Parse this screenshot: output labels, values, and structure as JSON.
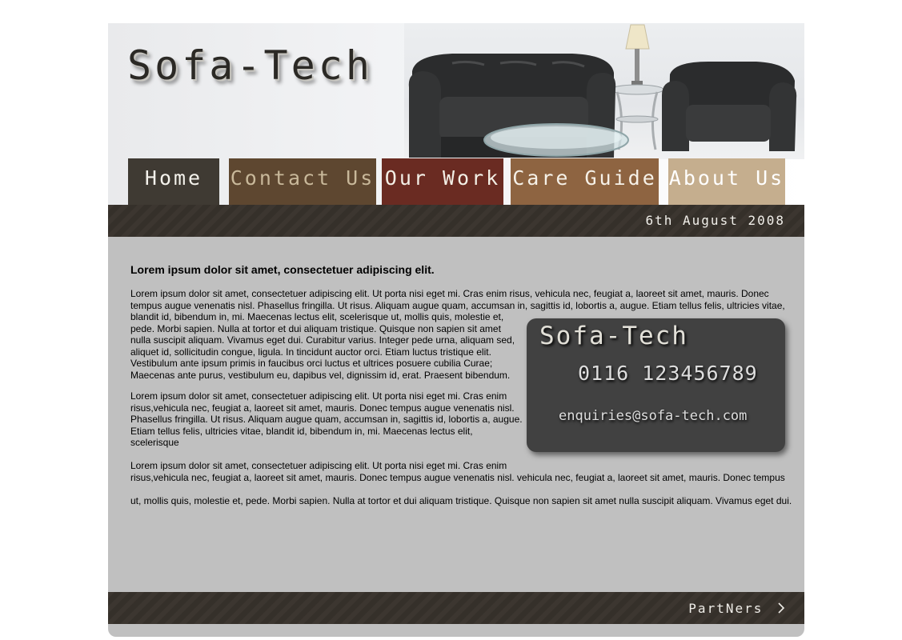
{
  "site": {
    "logo": "Sofa-Tech",
    "date": "6th August 2008"
  },
  "colors": {
    "page_background": "#c0c0c0",
    "dark_leather_bar": "#3a3530",
    "contact_card": "#414141"
  },
  "nav": {
    "items": [
      {
        "label": "Home",
        "color": "#3f3a33",
        "text_color": "#f4f2ec"
      },
      {
        "label": "Contact Us",
        "color": "#5e4730",
        "text_color": "#c8b89a"
      },
      {
        "label": "Our Work",
        "color": "#6a2b22",
        "text_color": "#f3efe6"
      },
      {
        "label": "Care Guide",
        "color": "#8e6441",
        "text_color": "#f6f1e8"
      },
      {
        "label": "About Us",
        "color": "#c5ae8e",
        "text_color": "#ffffff"
      }
    ]
  },
  "content": {
    "heading": "Lorem ipsum dolor sit amet, consectetuer adipiscing elit.",
    "paragraph1": [
      "Lorem ipsum dolor sit amet, consectetuer adipiscing elit. Ut porta nisi eget mi. Cras enim risus, vehicula nec, feugiat a, laoreet sit amet, mauris. Donec",
      "tempus augue venenatis nisl. Phasellus fringilla. Ut risus. Aliquam augue quam, accumsan in, sagittis id, lobortis a, augue. Etiam tellus felis, ultricies vitae,",
      "blandit id, bibendum in, mi. Maecenas lectus elit, scelerisque ut, mollis quis, molestie et,",
      "pede. Morbi sapien. Nulla at tortor et dui aliquam tristique. Quisque non sapien sit amet",
      " nulla suscipit aliquam. Vivamus eget dui. Curabitur varius. Integer pede urna, aliquam sed,",
      " aliquet id, sollicitudin congue, ligula. In tincidunt auctor orci. Etiam luctus tristique elit.",
      "Vestibulum ante ipsum primis in faucibus orci luctus et ultrices posuere cubilia Curae;",
      "Maecenas ante purus, vestibulum eu, dapibus vel, dignissim id, erat. Praesent bibendum."
    ],
    "paragraph2": [
      "Lorem ipsum dolor sit amet, consectetuer adipiscing elit. Ut porta nisi eget mi. Cras enim",
      "risus,vehicula nec, feugiat a, laoreet sit amet, mauris. Donec tempus augue venenatis nisl.",
      "Phasellus fringilla. Ut risus. Aliquam augue quam, accumsan in, sagittis id, lobortis a, augue.",
      " Etiam tellus felis, ultricies vitae, blandit id, bibendum in, mi. Maecenas lectus elit,",
      "scelerisque"
    ],
    "paragraph3": [
      "Lorem ipsum dolor sit amet, consectetuer adipiscing elit. Ut porta nisi eget mi. Cras enim",
      "risus,vehicula nec, feugiat a, laoreet sit amet, mauris. Donec tempus augue venenatis nisl. vehicula nec, feugiat a, laoreet sit amet, mauris. Donec tempus"
    ],
    "paragraph4": [
      "ut, mollis quis, molestie et, pede. Morbi sapien. Nulla at tortor et dui aliquam tristique. Quisque non sapien sit amet nulla suscipit aliquam. Vivamus eget dui."
    ]
  },
  "contact_card": {
    "title": "Sofa-Tech",
    "phone": "0116 123456789",
    "email": "enquiries@sofa-tech.com"
  },
  "footer": {
    "partners_label": "PartNers",
    "chevron_icon": "chevron-right-icon"
  }
}
